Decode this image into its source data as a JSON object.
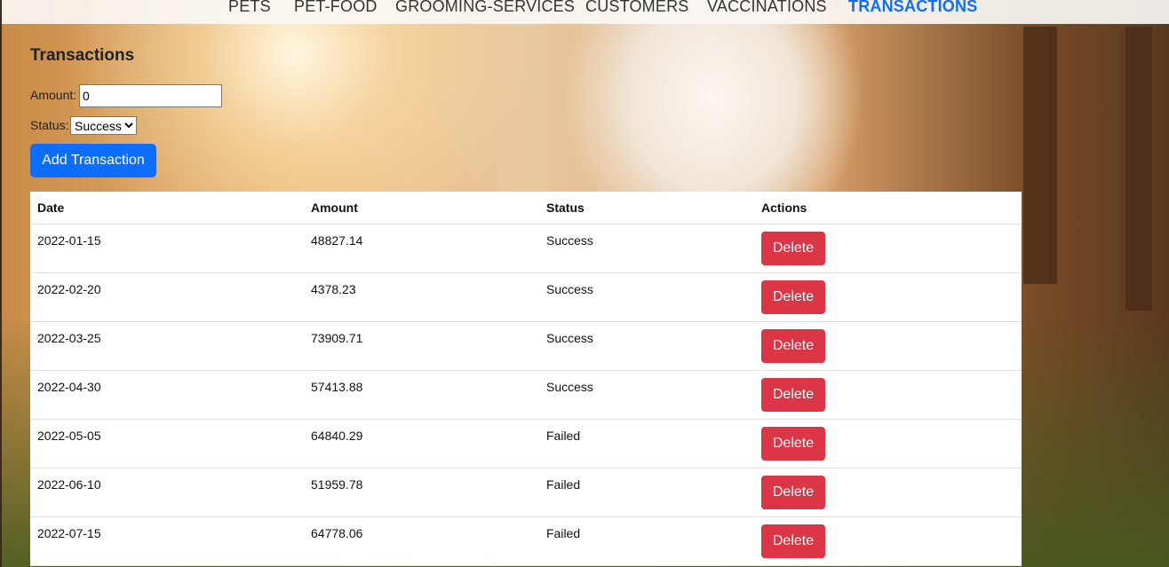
{
  "nav": {
    "items": [
      "PETS",
      "PET-FOOD",
      "GROOMING-SERVICES",
      "CUSTOMERS",
      "VACCINATIONS",
      "TRANSACTIONS"
    ],
    "active": "TRANSACTIONS"
  },
  "form": {
    "title": "Transactions",
    "amount_label": "Amount:",
    "amount_value": "0",
    "status_label": "Status:",
    "status_value": "Success",
    "add_label": "Add Transaction"
  },
  "table": {
    "headers": [
      "Date",
      "Amount",
      "Status",
      "Actions"
    ],
    "rows": [
      {
        "date": "2022-01-15",
        "amount": "48827.14",
        "status": "Success"
      },
      {
        "date": "2022-02-20",
        "amount": "4378.23",
        "status": "Success"
      },
      {
        "date": "2022-03-25",
        "amount": "73909.71",
        "status": "Success"
      },
      {
        "date": "2022-04-30",
        "amount": "57413.88",
        "status": "Success"
      },
      {
        "date": "2022-05-05",
        "amount": "64840.29",
        "status": "Failed"
      },
      {
        "date": "2022-06-10",
        "amount": "51959.78",
        "status": "Failed"
      },
      {
        "date": "2022-07-15",
        "amount": "64778.06",
        "status": "Failed"
      }
    ],
    "delete_label": "Delete"
  },
  "colors": {
    "accent": "#0d6efd",
    "danger": "#dc3545"
  }
}
